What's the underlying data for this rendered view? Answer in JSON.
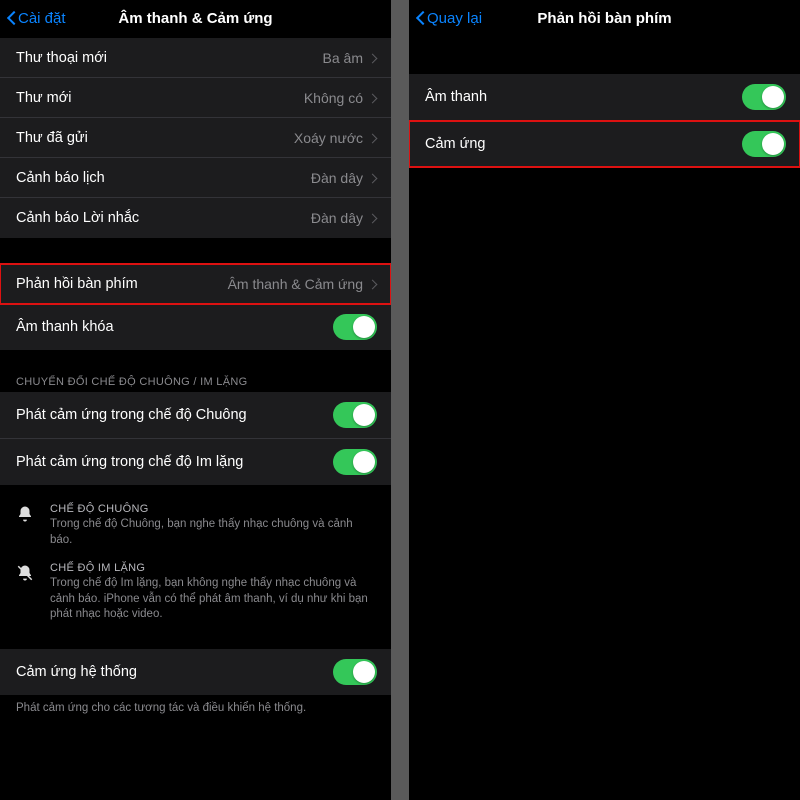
{
  "left": {
    "nav_back": "Cài đặt",
    "nav_title": "Âm thanh & Cảm ứng",
    "group1": [
      {
        "label": "Thư thoại mới",
        "value": "Ba âm"
      },
      {
        "label": "Thư mới",
        "value": "Không có"
      },
      {
        "label": "Thư đã gửi",
        "value": "Xoáy nước"
      },
      {
        "label": "Cảnh báo lịch",
        "value": "Đàn dây"
      },
      {
        "label": "Cảnh báo Lời nhắc",
        "value": "Đàn dây"
      }
    ],
    "group2_keyboard": {
      "label": "Phản hồi bàn phím",
      "value": "Âm thanh & Cảm ứng"
    },
    "group2_lock": {
      "label": "Âm thanh khóa"
    },
    "group3_header": "CHUYỂN ĐỔI CHẾ ĐỘ CHUÔNG / IM LẶNG",
    "group3": [
      {
        "label": "Phát cảm ứng trong chế độ Chuông"
      },
      {
        "label": "Phát cảm ứng trong chế độ Im lặng"
      }
    ],
    "info_ring_title": "CHẾ ĐỘ CHUÔNG",
    "info_ring_desc": "Trong chế độ Chuông, bạn nghe thấy nhạc chuông và cảnh báo.",
    "info_silent_title": "CHẾ ĐỘ IM LẶNG",
    "info_silent_desc": "Trong chế độ Im lặng, bạn không nghe thấy nhạc chuông và cảnh báo. iPhone vẫn có thể phát âm thanh, ví dụ như khi bạn phát nhạc hoặc video.",
    "group4_system": {
      "label": "Cảm ứng hệ thống"
    },
    "footer": "Phát cảm ứng cho các tương tác và điều khiển hệ thống."
  },
  "right": {
    "nav_back": "Quay lại",
    "nav_title": "Phản hồi bàn phím",
    "rows": [
      {
        "label": "Âm thanh"
      },
      {
        "label": "Cảm ứng"
      }
    ]
  }
}
